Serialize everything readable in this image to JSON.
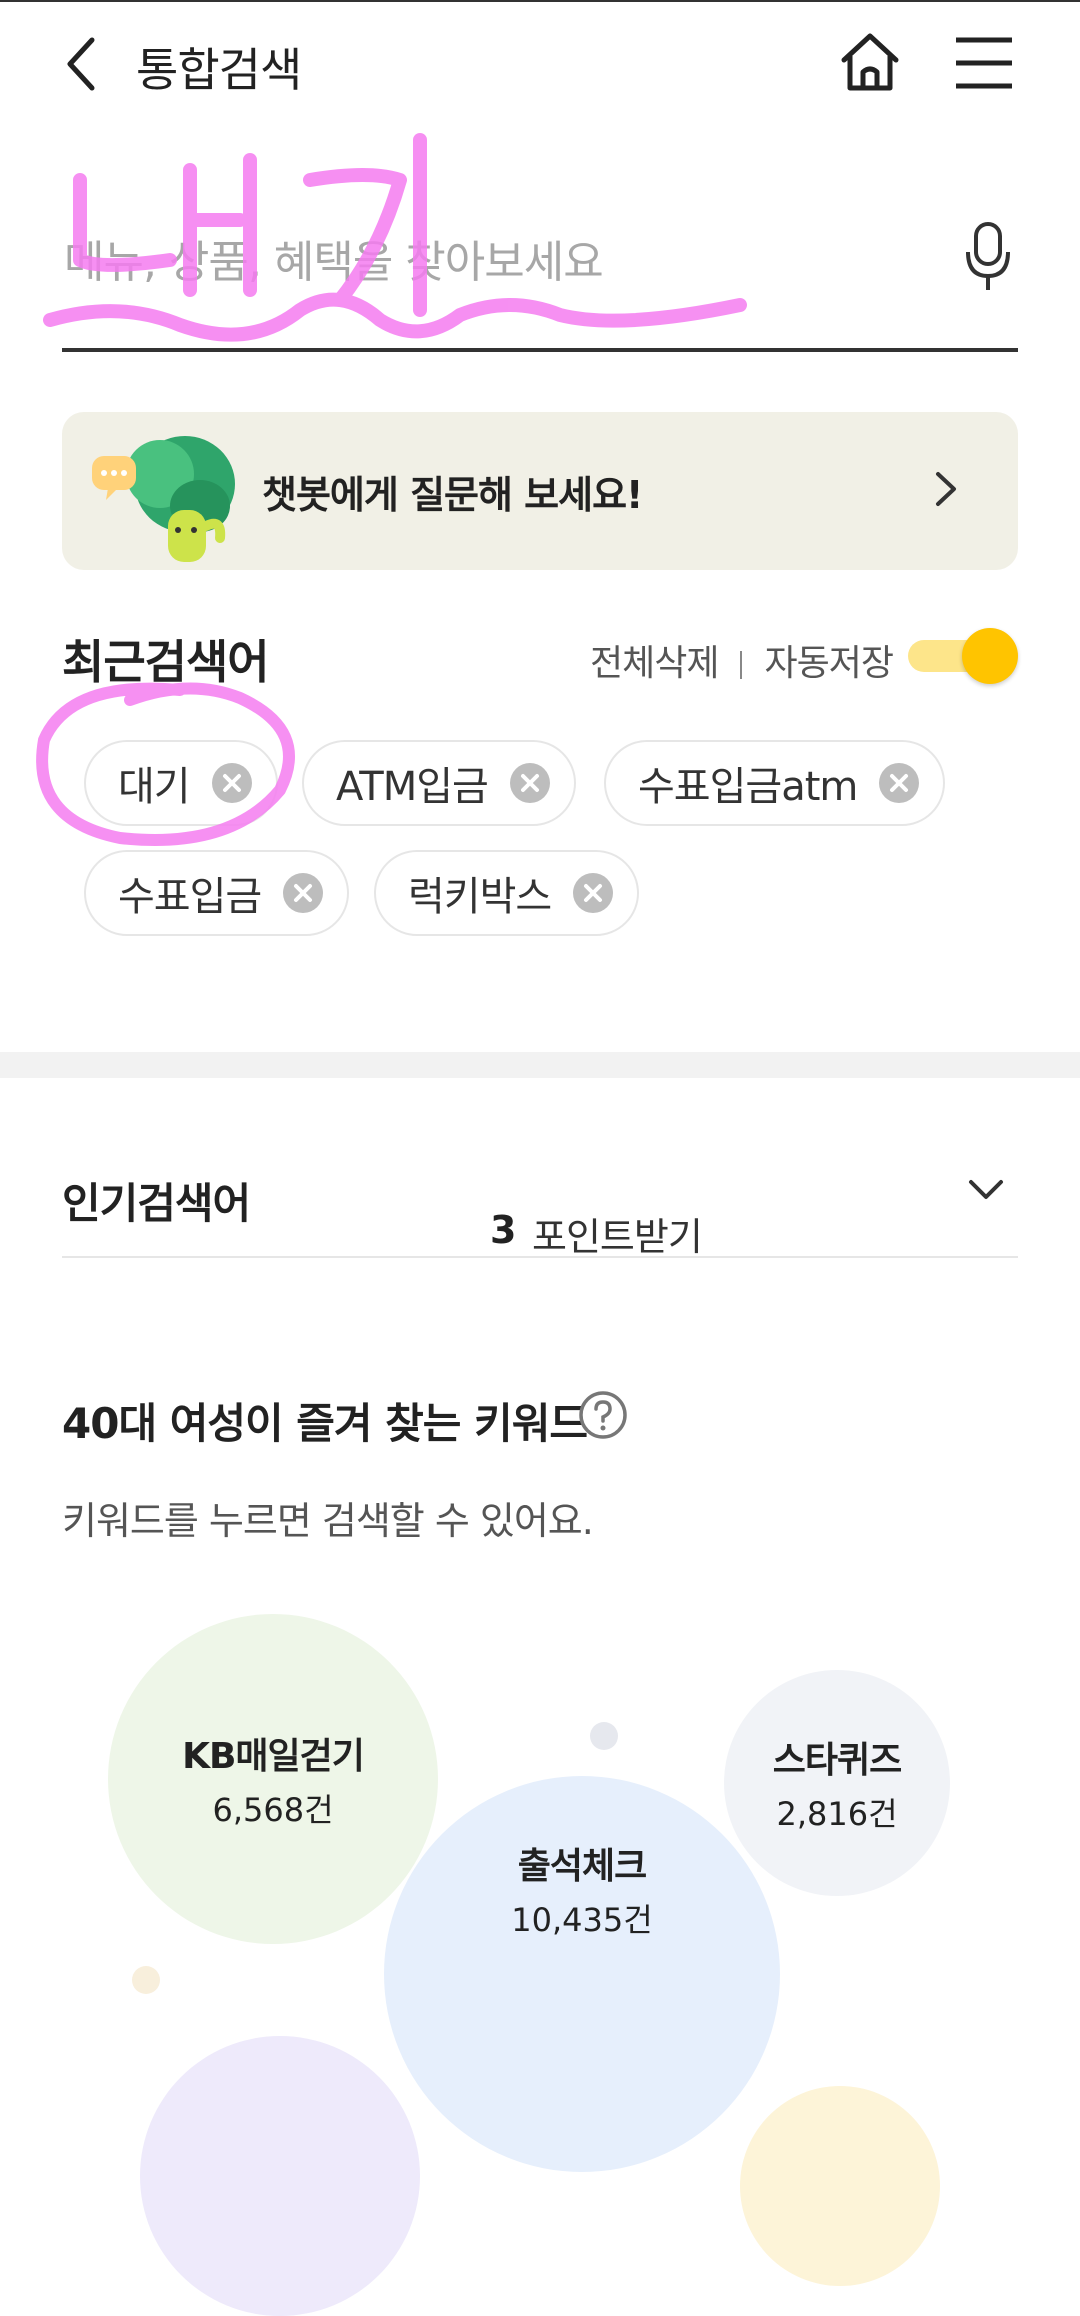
{
  "header": {
    "title": "통합검색"
  },
  "search": {
    "placeholder": "메뉴, 상품, 혜택을 찾아보세요",
    "value": ""
  },
  "chatbot": {
    "text": "챗봇에게 질문해 보세요!"
  },
  "recent": {
    "title": "최근검색어",
    "delete_all": "전체삭제",
    "auto_save": "자동저장",
    "auto_save_on": true,
    "chips": [
      {
        "label": "대기"
      },
      {
        "label": "ATM입금"
      },
      {
        "label": "수표입금atm"
      },
      {
        "label": "수표입금"
      },
      {
        "label": "럭키박스"
      }
    ]
  },
  "popular": {
    "title": "인기검색어",
    "rank": "3",
    "keyword": "포인트받기"
  },
  "keywords": {
    "title": "40대 여성이 즐겨 찾는 키워드",
    "subtitle": "키워드를 누르면 검색할 수 있어요.",
    "bubbles": [
      {
        "name": "KB매일걷기",
        "count": "6,568건",
        "color": "#eef6e8"
      },
      {
        "name": "스타퀴즈",
        "count": "2,816건",
        "color": "#f1f3f7"
      },
      {
        "name": "출석체크",
        "count": "10,435건",
        "color": "#e6effc"
      }
    ]
  },
  "colors": {
    "accent": "#ffc400",
    "accent_light": "#fde58a",
    "chatbot_bg": "#f1f0e6",
    "annotation": "#f57cf0"
  },
  "annotation": {
    "handwriting": "대기"
  }
}
